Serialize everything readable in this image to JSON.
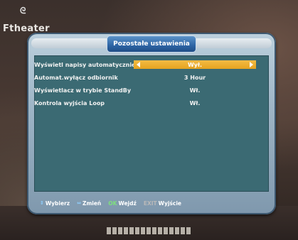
{
  "channel_logo": {
    "name": "Ftheater"
  },
  "dialog": {
    "title": "Pozostałe ustawienia"
  },
  "settings": [
    {
      "label": "Wyświetl napisy automatycznie",
      "value": "Wył.",
      "selected": true
    },
    {
      "label": "Automat.wyłącz odbiornik",
      "value": "3 Hour",
      "selected": false
    },
    {
      "label": "Wyświetlacz w trybie StandBy",
      "value": "Wł.",
      "selected": false
    },
    {
      "label": "Kontrola wyjścia Loop",
      "value": "Wł.",
      "selected": false
    }
  ],
  "footer": {
    "select_key": "⇕",
    "select_label": "Wybierz",
    "change_key": "⇔",
    "change_label": "Zmień",
    "ok_key": "OK",
    "ok_label": "Wejdź",
    "exit_key": "EXIT",
    "exit_label": "Wyjście"
  },
  "colors": {
    "panel": "#3b6a73",
    "highlight": "#e6a31f",
    "title_tab": "#2e64a4"
  }
}
